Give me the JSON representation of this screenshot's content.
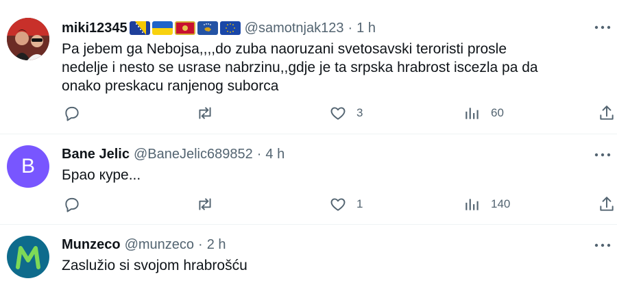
{
  "tweets": [
    {
      "display_name": "miki12345",
      "flags": [
        "flag-bosnia",
        "flag-ukraine",
        "flag-montenegro",
        "flag-kosovo",
        "flag-eu"
      ],
      "handle": "@samotnjak123",
      "separator": "·",
      "time": "1 h",
      "text_lines": [
        "Pa jebem ga Nebojsa,,,,do zuba naoruzani svetosavski teroristi prosle",
        "nedelje i nesto se usrase nabrzinu,,gdje je ta srpska hrabrost iscezla pa da",
        "onako preskacu ranjenog suborca"
      ],
      "replies": "",
      "retweets": "",
      "likes": "3",
      "views": "60"
    },
    {
      "display_name": "Bane Jelic",
      "avatar_letter": "B",
      "avatar_color": "#7856ff",
      "handle": "@BaneJelic689852",
      "separator": "·",
      "time": "4 h",
      "text_lines": [
        "Брао куре..."
      ],
      "replies": "",
      "retweets": "",
      "likes": "1",
      "views": "140"
    },
    {
      "display_name": "Munzeco",
      "handle": "@munzeco",
      "separator": "·",
      "time": "2 h",
      "text_lines": [
        "Zaslužio si svojom hrabrošću"
      ]
    }
  ],
  "icons": {
    "reply": "reply-icon",
    "retweet": "retweet-icon",
    "like": "heart-icon",
    "views": "views-icon",
    "share": "share-icon",
    "more": "more-icon"
  },
  "colors": {
    "text": "#0f1419",
    "secondary": "#536471",
    "divider": "#eff3f4"
  }
}
